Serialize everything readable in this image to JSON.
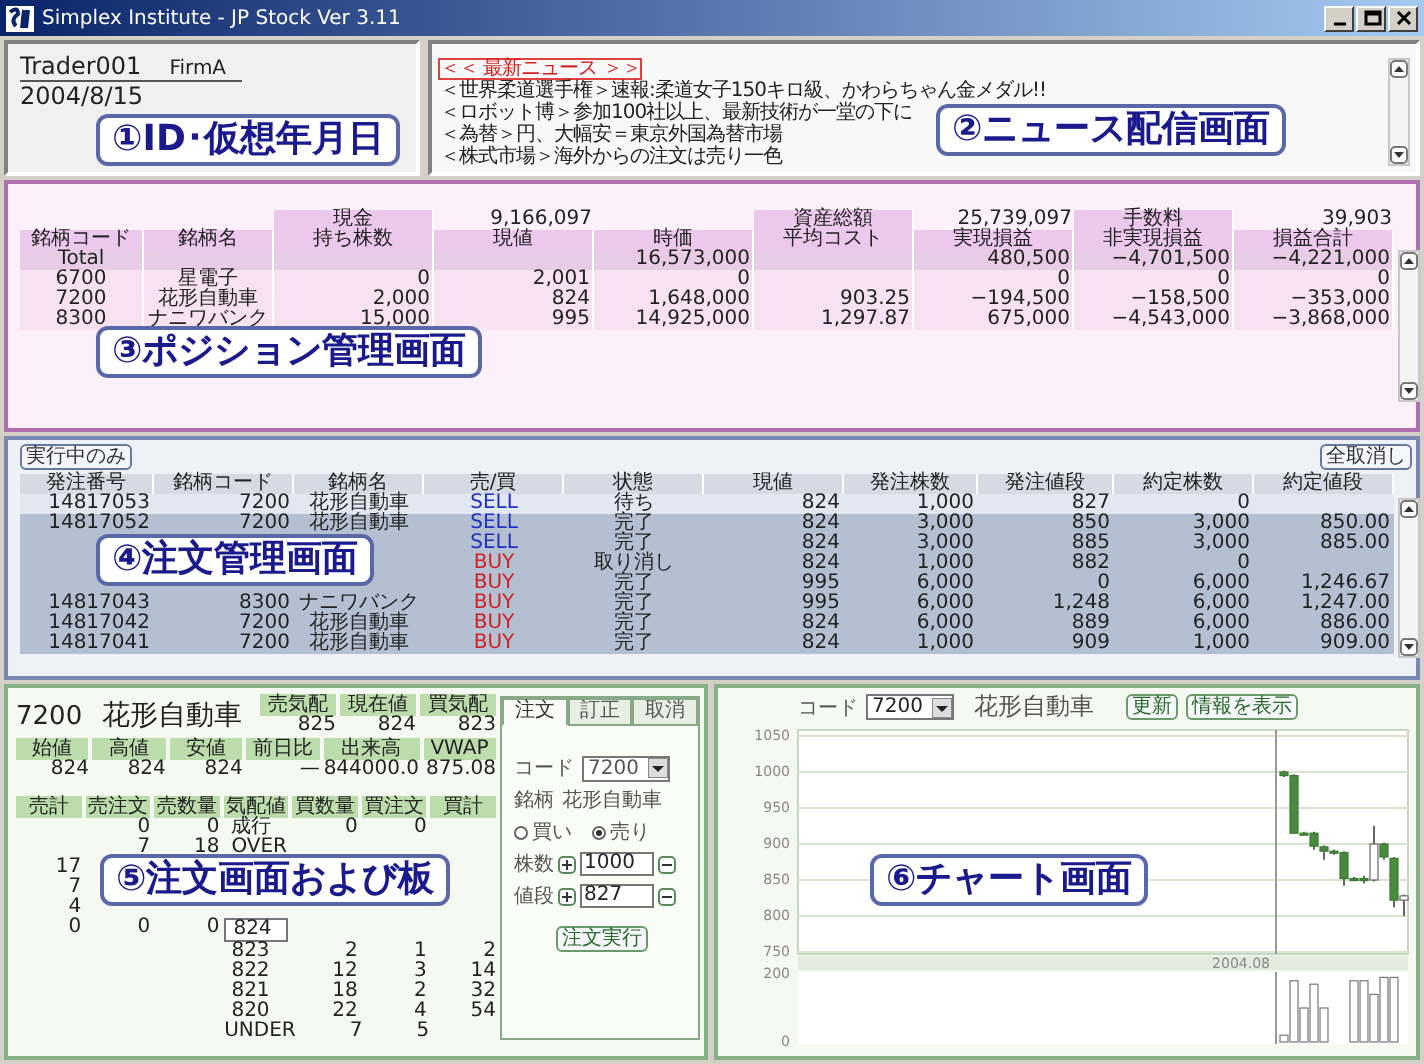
{
  "window": {
    "title": "Simplex Institute - JP Stock Ver 3.11"
  },
  "account": {
    "trader": "Trader001",
    "firm": "FirmA",
    "date": "2004/8/15",
    "caption": "①ID･仮想年月日"
  },
  "news": {
    "caption": "②ニュース配信画面",
    "items": [
      {
        "text": "＜＜ 最新ニュース ＞＞",
        "kind": "header",
        "selected": true
      },
      {
        "text": "＜世界柔道選手権＞速報:柔道女子150キロ級、かわらちゃん金メダル!!",
        "kind": "item",
        "selected": false
      },
      {
        "text": "＜ロボット博＞参加100社以上、最新技術が一堂の下に",
        "kind": "item",
        "selected": false
      },
      {
        "text": "＜為替＞円、大幅安＝東京外国為替市場",
        "kind": "item",
        "selected": false
      },
      {
        "text": "＜株式市場＞海外からの注文は売り一色",
        "kind": "item",
        "selected": false
      }
    ]
  },
  "positions": {
    "caption": "③ポジション管理画面",
    "summary": [
      {
        "label": "現金",
        "value": "9,166,097"
      },
      {
        "label": "資産総額",
        "value": "25,739,097"
      },
      {
        "label": "手数料",
        "value": "39,903"
      }
    ],
    "columns": [
      "銘柄コード",
      "銘柄名",
      "持ち株数",
      "現値",
      "時価",
      "平均コスト",
      "実現損益",
      "非実現損益",
      "損益合計"
    ],
    "rows": [
      {
        "kind": "total",
        "cells": [
          "Total",
          null,
          null,
          null,
          "16,573,000",
          null,
          "480,500",
          "−4,701,500",
          "−4,221,000"
        ]
      },
      {
        "kind": "stock",
        "cells": [
          "6700",
          "星電子",
          "0",
          "2,001",
          "0",
          null,
          "0",
          "0",
          "0"
        ]
      },
      {
        "kind": "stock",
        "cells": [
          "7200",
          "花形自動車",
          "2,000",
          "824",
          "1,648,000",
          "903.25",
          "−194,500",
          "−158,500",
          "−353,000"
        ]
      },
      {
        "kind": "stock",
        "cells": [
          "8300",
          "ナニワバンク",
          "15,000",
          "995",
          "14,925,000",
          "1,297.87",
          "675,000",
          "−4,543,000",
          "−3,868,000"
        ]
      }
    ]
  },
  "orders": {
    "caption": "④注文管理画面",
    "buttons": [
      "実行中のみ",
      "全取消し"
    ],
    "columns": [
      "発注番号",
      "銘柄コード",
      "銘柄名",
      "売/買",
      "状態",
      "現値",
      "発注株数",
      "発注値段",
      "約定株数",
      "約定値段"
    ],
    "rows": [
      {
        "selected": true,
        "kind": "sell",
        "cells": [
          "14817053",
          "7200",
          "花形自動車",
          "SELL",
          "待ち",
          "824",
          "1,000",
          "827",
          "0",
          null
        ]
      },
      {
        "selected": false,
        "kind": "sell",
        "cells": [
          "14817052",
          "7200",
          "花形自動車",
          "SELL",
          "完了",
          "824",
          "3,000",
          "850",
          "3,000",
          "850.00"
        ]
      },
      {
        "selected": false,
        "kind": "sell",
        "cells": [
          null,
          null,
          null,
          "SELL",
          "完了",
          "824",
          "3,000",
          "885",
          "3,000",
          "885.00"
        ]
      },
      {
        "selected": false,
        "kind": "buy",
        "cells": [
          null,
          null,
          null,
          "BUY",
          "取り消し",
          "824",
          "1,000",
          "882",
          "0",
          null
        ]
      },
      {
        "selected": false,
        "kind": "buy",
        "cells": [
          null,
          null,
          null,
          "BUY",
          "完了",
          "995",
          "6,000",
          "0",
          "6,000",
          "1,246.67"
        ]
      },
      {
        "selected": false,
        "kind": "buy",
        "cells": [
          "14817043",
          "8300",
          "ナニワバンク",
          "BUY",
          "完了",
          "995",
          "6,000",
          "1,248",
          "6,000",
          "1,247.00"
        ]
      },
      {
        "selected": false,
        "kind": "buy",
        "cells": [
          "14817042",
          "7200",
          "花形自動車",
          "BUY",
          "完了",
          "824",
          "6,000",
          "889",
          "6,000",
          "886.00"
        ]
      },
      {
        "selected": false,
        "kind": "buy",
        "cells": [
          "14817041",
          "7200",
          "花形自動車",
          "BUY",
          "完了",
          "824",
          "1,000",
          "909",
          "1,000",
          "909.00"
        ]
      }
    ]
  },
  "board": {
    "caption": "⑤注文画面および板",
    "code": "7200",
    "name": "花形自動車",
    "quotes": [
      {
        "label": "売気配",
        "value": "825"
      },
      {
        "label": "現在値",
        "value": "824"
      },
      {
        "label": "買気配",
        "value": "823"
      }
    ],
    "stats": [
      {
        "label": "始値",
        "value": "824"
      },
      {
        "label": "高値",
        "value": "824"
      },
      {
        "label": "安値",
        "value": "824"
      },
      {
        "label": "前日比",
        "value": "—"
      },
      {
        "label": "出来高",
        "value": "844000.0"
      },
      {
        "label": "VWAP",
        "value": "875.08"
      }
    ],
    "columns": [
      "売計",
      "売注文",
      "売数量",
      "気配値",
      "買数量",
      "買注文",
      "買計"
    ],
    "rows": [
      {
        "current": false,
        "cells": [
          null,
          "0",
          "0",
          "成行",
          "0",
          "0",
          null
        ]
      },
      {
        "current": false,
        "cells": [
          null,
          "7",
          "18",
          "OVER",
          null,
          null,
          null
        ]
      },
      {
        "current": false,
        "cells": [
          "17",
          null,
          null,
          null,
          null,
          null,
          null
        ]
      },
      {
        "current": false,
        "cells": [
          "7",
          null,
          null,
          null,
          null,
          null,
          null
        ]
      },
      {
        "current": false,
        "cells": [
          "4",
          null,
          null,
          null,
          null,
          null,
          null
        ]
      },
      {
        "current": true,
        "cells": [
          "0",
          "0",
          "0",
          "824",
          null,
          null,
          null
        ]
      },
      {
        "current": false,
        "cells": [
          null,
          null,
          null,
          "823",
          "2",
          "1",
          "2"
        ]
      },
      {
        "current": false,
        "cells": [
          null,
          null,
          null,
          "822",
          "12",
          "3",
          "14"
        ]
      },
      {
        "current": false,
        "cells": [
          null,
          null,
          null,
          "821",
          "18",
          "2",
          "32"
        ]
      },
      {
        "current": false,
        "cells": [
          null,
          null,
          null,
          "820",
          "22",
          "4",
          "54"
        ]
      },
      {
        "current": false,
        "cells": [
          null,
          null,
          null,
          "UNDER",
          "7",
          "5",
          null
        ]
      }
    ]
  },
  "order_form": {
    "tabs": [
      {
        "label": "注文",
        "selected": true
      },
      {
        "label": "訂正",
        "selected": false
      },
      {
        "label": "取消",
        "selected": false
      }
    ],
    "code_label": "コード",
    "code": "7200",
    "name_label": "銘柄",
    "name": "花形自動車",
    "sides": [
      {
        "label": "買い",
        "selected": false
      },
      {
        "label": "売り",
        "selected": true
      }
    ],
    "quantity_label": "株数",
    "quantity": "1000",
    "price_label": "値段",
    "price": "827",
    "submit": "注文実行"
  },
  "chart": {
    "caption": "⑥チャート画面",
    "code_label": "コード",
    "code": "7200",
    "name": "花形自動車",
    "buttons": [
      "更新",
      "情報を表示"
    ],
    "price_ticks": [
      "1050",
      "1000",
      "950",
      "900",
      "850",
      "800",
      "750"
    ],
    "volume_ticks": [
      "200",
      "0"
    ],
    "date_label": "2004.08"
  }
}
